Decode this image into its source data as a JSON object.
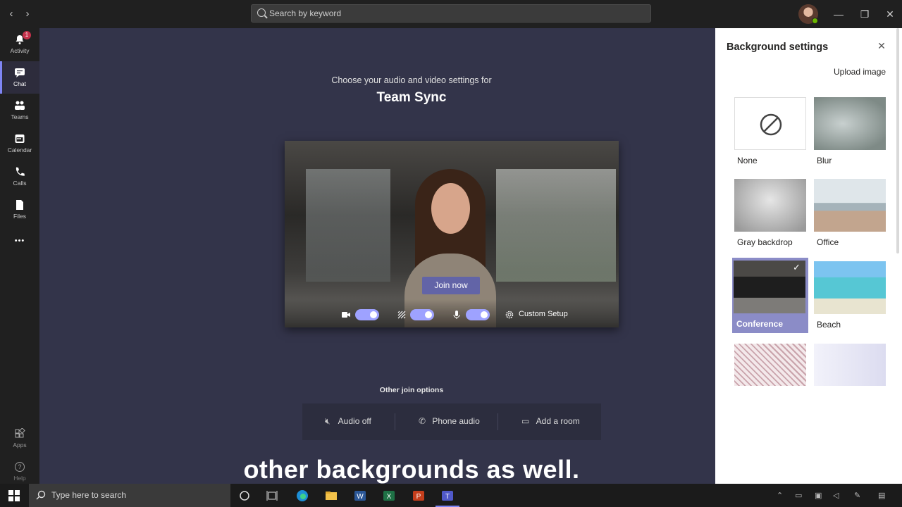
{
  "titlebar": {
    "search_placeholder": "Search by keyword",
    "back_glyph": "‹",
    "forward_glyph": "›",
    "minimize_glyph": "—",
    "maximize_glyph": "❐",
    "close_glyph": "✕"
  },
  "rail": {
    "items": [
      {
        "label": "Activity",
        "icon": "bell-icon",
        "badge": "1"
      },
      {
        "label": "Chat",
        "icon": "chat-icon"
      },
      {
        "label": "Teams",
        "icon": "teams-icon"
      },
      {
        "label": "Calendar",
        "icon": "calendar-icon"
      },
      {
        "label": "Calls",
        "icon": "phone-icon"
      },
      {
        "label": "Files",
        "icon": "file-icon"
      }
    ],
    "more_glyph": "•••",
    "apps_label": "Apps",
    "help_label": "Help"
  },
  "stage": {
    "subtitle": "Choose your audio and video settings for",
    "meeting_title": "Team Sync",
    "join_label": "Join now",
    "custom_setup_label": "Custom Setup",
    "other_options_label": "Other join options",
    "options": [
      "Audio off",
      "Phone audio",
      "Add a room"
    ],
    "caption": "other backgrounds as well."
  },
  "panel": {
    "title": "Background settings",
    "close_glyph": "✕",
    "upload_label": "Upload image",
    "tiles": [
      {
        "label": "None"
      },
      {
        "label": "Blur"
      },
      {
        "label": "Gray backdrop"
      },
      {
        "label": "Office"
      },
      {
        "label": "Conference",
        "selected": true
      },
      {
        "label": "Beach"
      }
    ]
  },
  "taskbar": {
    "search_placeholder": "Type here to search"
  },
  "colors": {
    "accent": "#6264a7",
    "toggle_on": "#9ea2ff",
    "selected_tile": "#8b8cc7",
    "stage_bg": "#33344a"
  }
}
